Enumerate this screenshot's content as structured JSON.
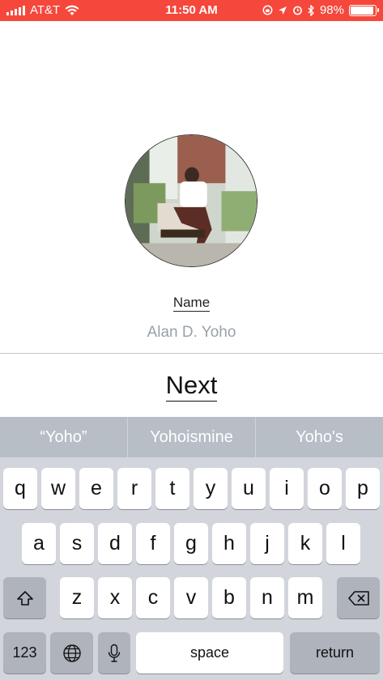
{
  "status_bar": {
    "carrier": "AT&T",
    "time": "11:50 AM",
    "battery_percent": "98%",
    "battery_level": 0.98,
    "color": "#f5473b"
  },
  "profile": {
    "name_label": "Name",
    "name_value": "Alan D. Yoho"
  },
  "next_label": "Next",
  "keyboard": {
    "suggestions": [
      "“Yoho”",
      "Yohoismine",
      "Yoho's"
    ],
    "row1": [
      "q",
      "w",
      "e",
      "r",
      "t",
      "y",
      "u",
      "i",
      "o",
      "p"
    ],
    "row2": [
      "a",
      "s",
      "d",
      "f",
      "g",
      "h",
      "j",
      "k",
      "l"
    ],
    "row3": [
      "z",
      "x",
      "c",
      "v",
      "b",
      "n",
      "m"
    ],
    "numbers_label": "123",
    "space_label": "space",
    "return_label": "return"
  }
}
